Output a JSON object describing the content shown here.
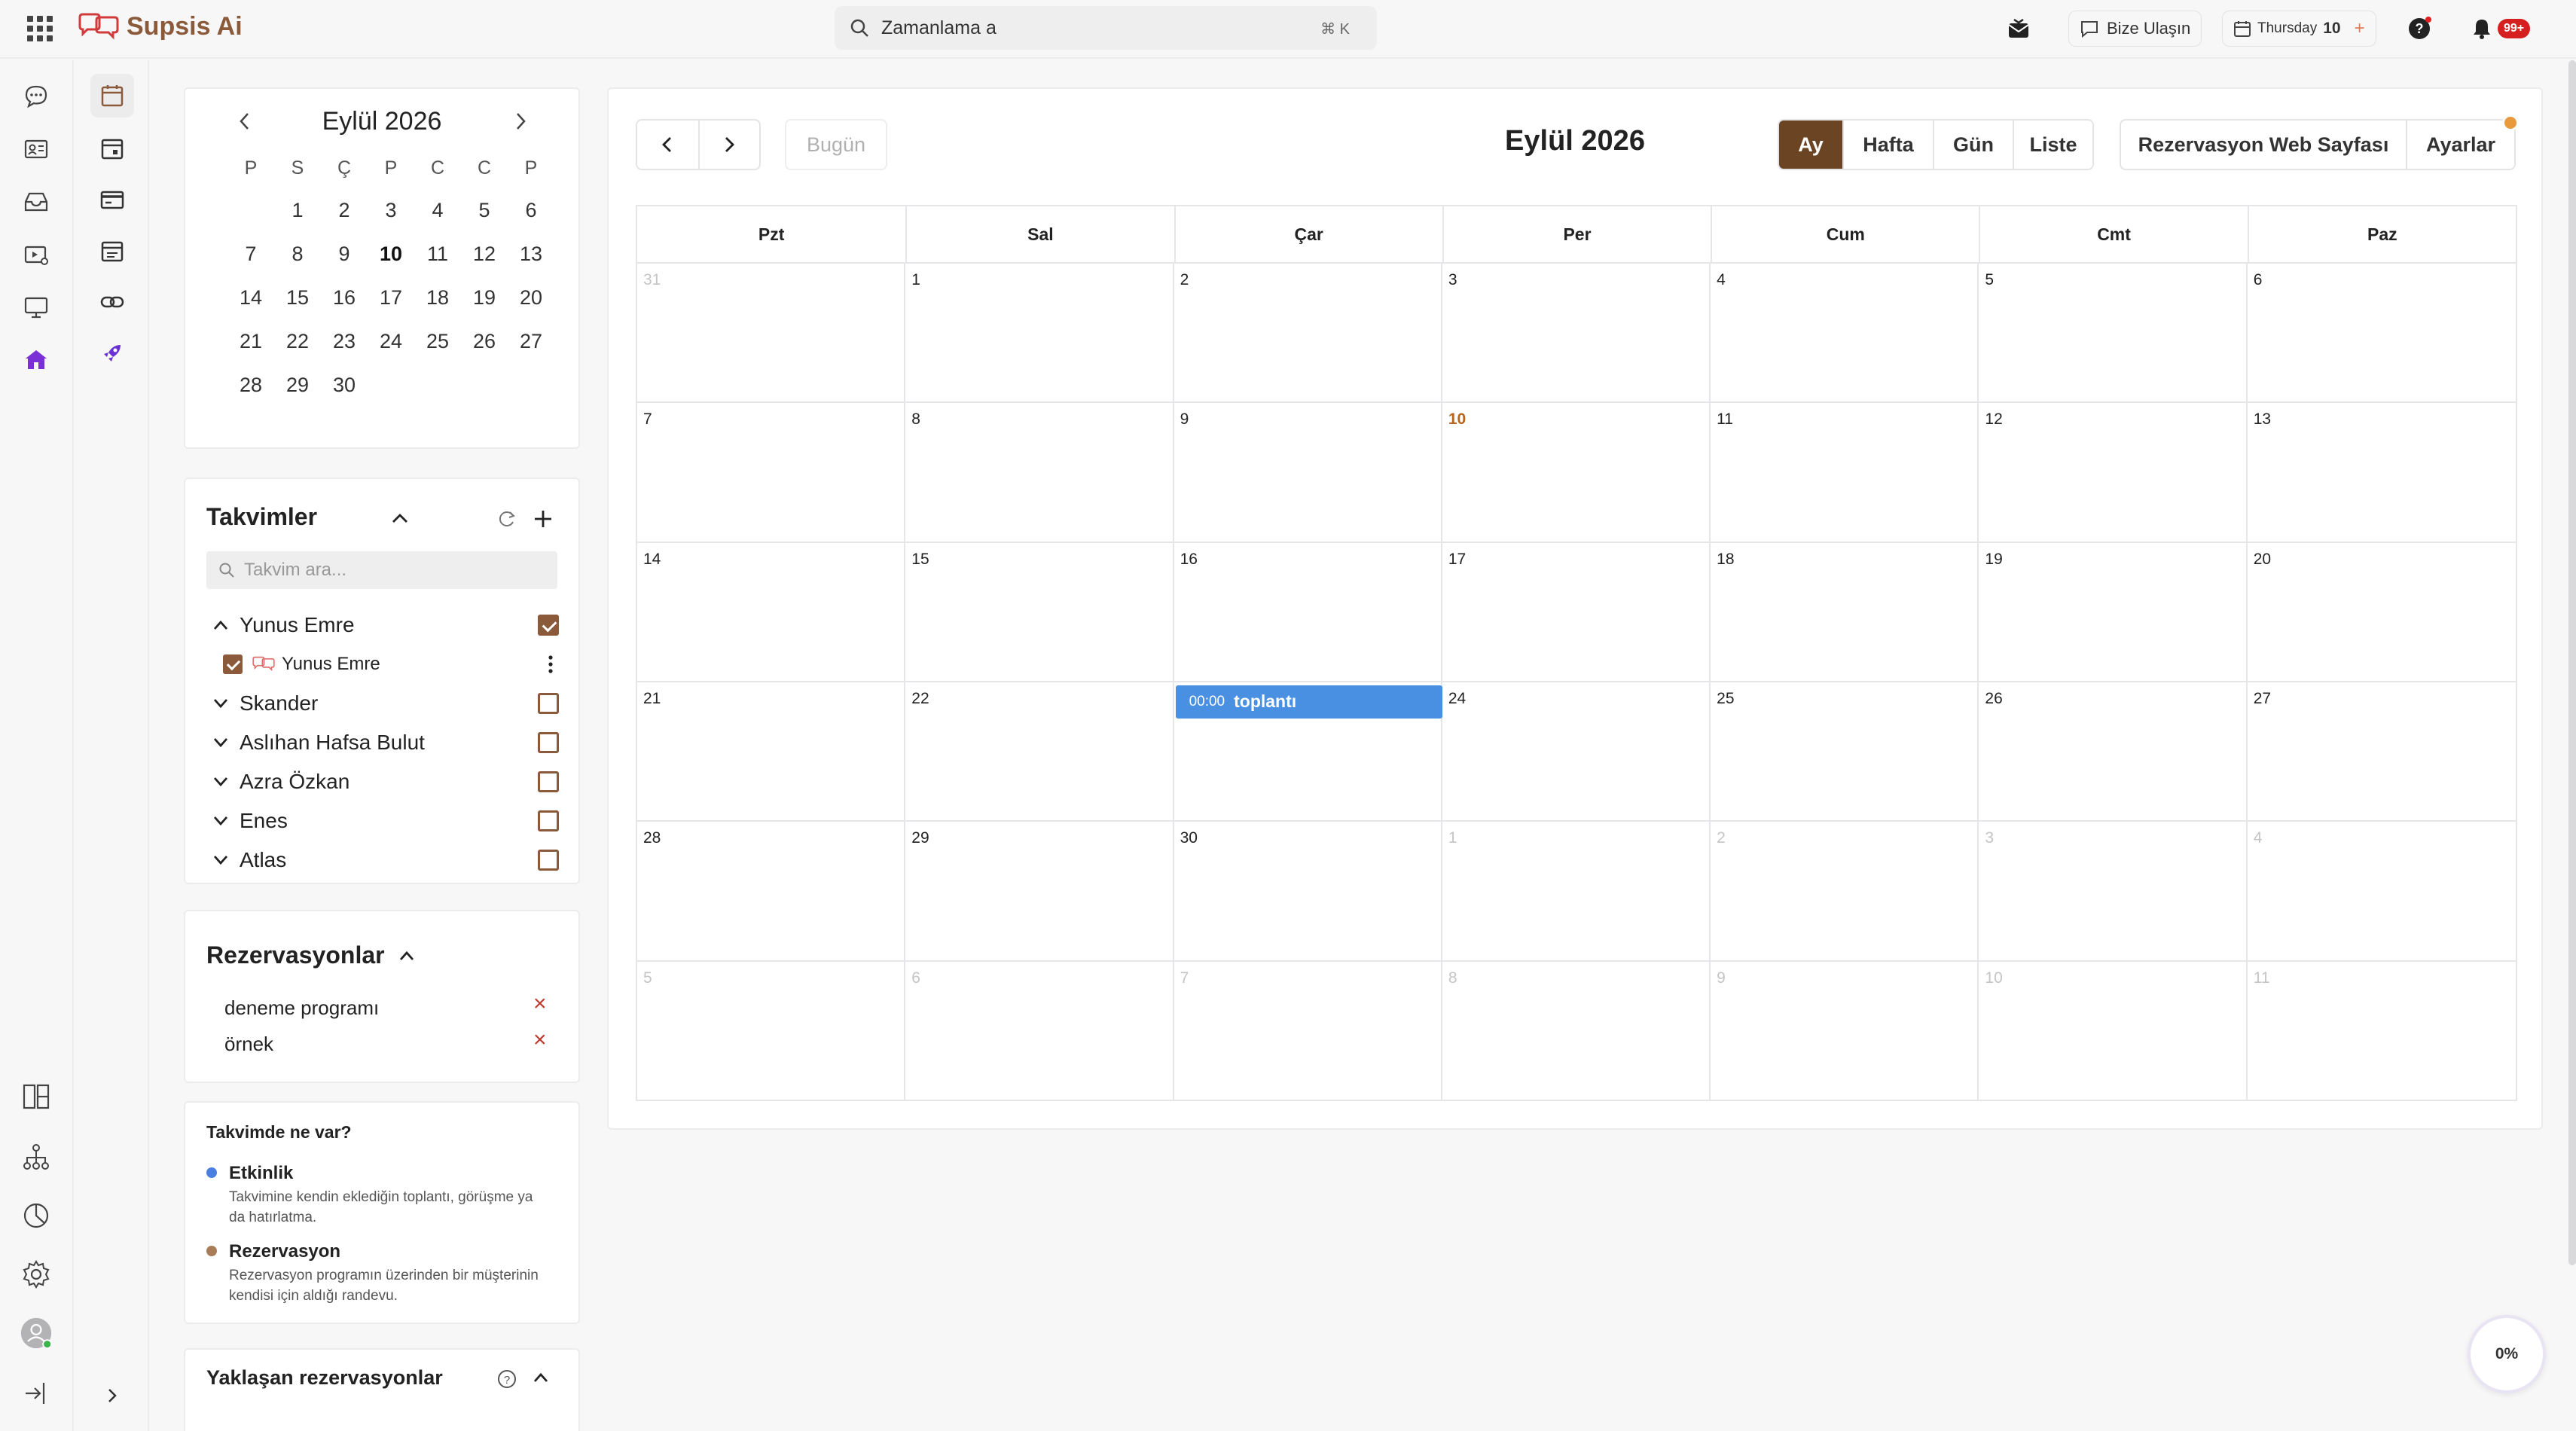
{
  "app": {
    "name": "Supsis Ai"
  },
  "topbar": {
    "search_value": "Zamanlama a",
    "search_shortcut": "⌘ K",
    "contact_label": "Bize Ulaşın",
    "date_day": "Thursday",
    "date_num": "10",
    "notifications_badge": "99+"
  },
  "mini_calendar": {
    "title": "Eylül 2026",
    "weekdays": [
      "P",
      "S",
      "Ç",
      "P",
      "C",
      "C",
      "P"
    ],
    "days": [
      "",
      "1",
      "2",
      "3",
      "4",
      "5",
      "6",
      "7",
      "8",
      "9",
      "10",
      "11",
      "12",
      "13",
      "14",
      "15",
      "16",
      "17",
      "18",
      "19",
      "20",
      "21",
      "22",
      "23",
      "24",
      "25",
      "26",
      "27",
      "28",
      "29",
      "30"
    ]
  },
  "calendars": {
    "title": "Takvimler",
    "search_placeholder": "Takvim ara...",
    "owner": "Yunus Emre",
    "sub_item": "Yunus Emre",
    "others": [
      "Skander",
      "Aslıhan Hafsa Bulut",
      "Azra Özkan",
      "Enes",
      "Atlas"
    ]
  },
  "reservations": {
    "title": "Rezervasyonlar",
    "items": [
      "deneme programı",
      "örnek"
    ]
  },
  "legend": {
    "title": "Takvimde ne var?",
    "event_name": "Etkinlik",
    "event_desc": "Takvimine kendin eklediğin toplantı, görüşme ya da hatırlatma.",
    "event_color": "#4a7fe0",
    "reservation_name": "Rezervasyon",
    "reservation_desc": "Rezervasyon programın üzerinden bir müşterinin kendisi için aldığı randevu.",
    "reservation_color": "#a97c58"
  },
  "upcoming": {
    "title": "Yaklaşan rezervasyonlar"
  },
  "main": {
    "today_label": "Bugün",
    "month_title": "Eylül 2026",
    "views": [
      "Ay",
      "Hafta",
      "Gün",
      "Liste"
    ],
    "active_view": "Ay",
    "booking_page_label": "Rezervasyon Web Sayfası",
    "settings_label": "Ayarlar",
    "weekdays": [
      "Pzt",
      "Sal",
      "Çar",
      "Per",
      "Cum",
      "Cmt",
      "Paz"
    ],
    "days": [
      {
        "n": "31",
        "other": true
      },
      {
        "n": "1"
      },
      {
        "n": "2"
      },
      {
        "n": "3"
      },
      {
        "n": "4"
      },
      {
        "n": "5"
      },
      {
        "n": "6"
      },
      {
        "n": "7"
      },
      {
        "n": "8"
      },
      {
        "n": "9"
      },
      {
        "n": "10",
        "today": true
      },
      {
        "n": "11"
      },
      {
        "n": "12"
      },
      {
        "n": "13"
      },
      {
        "n": "14"
      },
      {
        "n": "15"
      },
      {
        "n": "16"
      },
      {
        "n": "17"
      },
      {
        "n": "18"
      },
      {
        "n": "19"
      },
      {
        "n": "20"
      },
      {
        "n": "21"
      },
      {
        "n": "22"
      },
      {
        "n": "23"
      },
      {
        "n": "24"
      },
      {
        "n": "25"
      },
      {
        "n": "26"
      },
      {
        "n": "27"
      },
      {
        "n": "28"
      },
      {
        "n": "29"
      },
      {
        "n": "30"
      },
      {
        "n": "1",
        "other": true
      },
      {
        "n": "2",
        "other": true
      },
      {
        "n": "3",
        "other": true
      },
      {
        "n": "4",
        "other": true
      },
      {
        "n": "5",
        "other": true
      },
      {
        "n": "6",
        "other": true
      },
      {
        "n": "7",
        "other": true
      },
      {
        "n": "8",
        "other": true
      },
      {
        "n": "9",
        "other": true
      },
      {
        "n": "10",
        "other": true
      },
      {
        "n": "11",
        "other": true
      }
    ],
    "event": {
      "time": "00:00",
      "title": "toplantı",
      "day": "23"
    }
  },
  "progress_label": "0%",
  "colors": {
    "brand": "#8a5a3b",
    "active_view_bg": "#6b4423",
    "event_bg": "#4a90e2",
    "today_text": "#b5651d",
    "rail_active": "#7b2fd6"
  }
}
